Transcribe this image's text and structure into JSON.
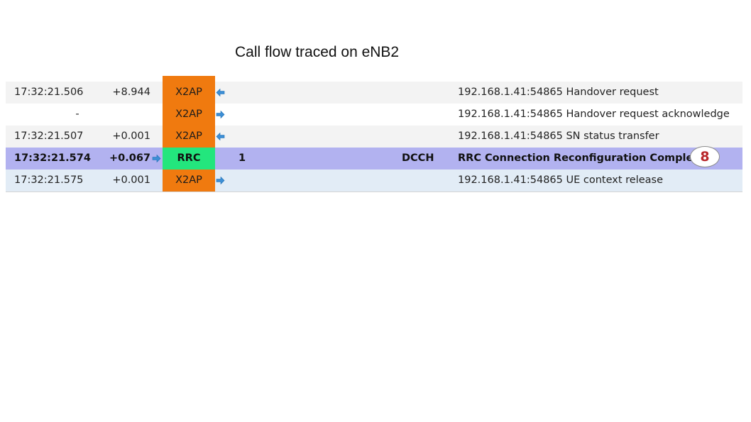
{
  "title": "Call flow traced on eNB2",
  "rows": [
    {
      "time": "17:32:21.506",
      "delta": "+8.944",
      "protocol": "X2AP",
      "direction": "incoming",
      "ue": "",
      "channel": "",
      "message": "192.168.1.41:54865 Handover request"
    },
    {
      "time": "-",
      "delta": "",
      "protocol": "X2AP",
      "direction": "outgoing",
      "ue": "",
      "channel": "",
      "message": "192.168.1.41:54865 Handover request acknowledge"
    },
    {
      "time": "17:32:21.507",
      "delta": "+0.001",
      "protocol": "X2AP",
      "direction": "incoming",
      "ue": "",
      "channel": "",
      "message": "192.168.1.41:54865 SN status transfer"
    },
    {
      "time": "17:32:21.574",
      "delta": "+0.067",
      "protocol": "RRC",
      "direction": "outgoing",
      "ue": "1",
      "channel": "DCCH",
      "message": "RRC Connection Reconfiguration Complete",
      "selected": true
    },
    {
      "time": "17:32:21.575",
      "delta": "+0.001",
      "protocol": "X2AP",
      "direction": "outgoing",
      "ue": "",
      "channel": "",
      "message": "192.168.1.41:54865 UE context release"
    }
  ],
  "step_badge": "8",
  "colors": {
    "x2ap": "#f07a0f",
    "rrc": "#23e67d",
    "selected_row": "#b2b2f0",
    "arrow": "#3d8fd6",
    "badge_text": "#b8262a"
  },
  "icons": {
    "incoming": "arrow-left-icon",
    "outgoing": "arrow-right-icon"
  }
}
